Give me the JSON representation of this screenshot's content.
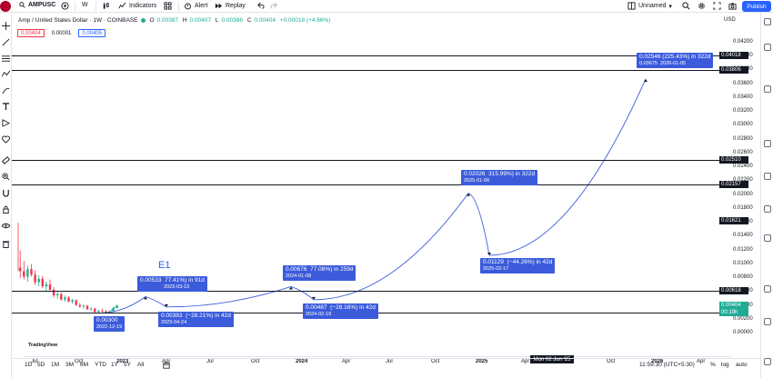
{
  "toolbar": {
    "symbol": "AMPUSC",
    "interval": "W",
    "indicators_label": "Indicators",
    "alert_label": "Alert",
    "replay_label": "Replay",
    "layout_name": "Unnamed",
    "publish_label": "Publish"
  },
  "legend": {
    "title": "Amp / United States Dollar · 1W · COINBASE",
    "open_label": "O",
    "open": "0.00387",
    "high_label": "H",
    "high": "0.00407",
    "low_label": "L",
    "low": "0.00386",
    "close_label": "C",
    "close": "0.00404",
    "change": "+0.00018 (+4.66%)",
    "bid": "0.00404",
    "spread": "0.00001",
    "ask": "0.00405"
  },
  "price_axis": {
    "currency": "USD",
    "ticks": [
      "0.04200",
      "0.04000",
      "0.03800",
      "0.03600",
      "0.03400",
      "0.03200",
      "0.03000",
      "0.02800",
      "0.02600",
      "0.02400",
      "0.02200",
      "0.02000",
      "0.01800",
      "0.01600",
      "0.01400",
      "0.01200",
      "0.01000",
      "0.00800",
      "0.00600",
      "0.00400",
      "0.00200",
      "0.00000"
    ],
    "levels": [
      "0.04018",
      "0.03806",
      "0.02510",
      "0.02157",
      "0.01621",
      "0.00618",
      "0.00404",
      "0.00301"
    ],
    "countdown": "00:19h"
  },
  "time_axis": {
    "ticks": [
      "Jul",
      "Oct",
      "2023",
      "Apr",
      "Jul",
      "Oct",
      "2024",
      "Apr",
      "Jul",
      "Oct",
      "2025",
      "Apr",
      "Jul",
      "Oct",
      "2026",
      "Apr"
    ],
    "crosshair_label": "Mon 02 Jun '25"
  },
  "annotations": {
    "wave_label": "E1",
    "tag1_price": "0.00300",
    "tag1_date": "2022-12-19",
    "tag2_price": "0.00533",
    "tag2_pct": "77.41%) in 91d",
    "tag2_date": "2023-03-13",
    "tag3_price": "0.00383",
    "tag3_pct": "(−28.21%) in 42d",
    "tag3_date": "2023-04-24",
    "tag4_price": "0.00676",
    "tag4_pct": "77.06%) in 259d",
    "tag4_date": "2024-01-08",
    "tag5_price": "0.00487",
    "tag5_pct": "(−28.16%) in 42d",
    "tag5_date": "2024-02-19",
    "tag6_price": "0.02026",
    "tag6_pct": "315.99%) in 322d",
    "tag6_date": "2025-01-06",
    "tag7_price": "0.01129",
    "tag7_pct": "(−44.26%) in 42d",
    "tag7_date": "2025-02-17",
    "tag8_pct": "0.02546 (225.43%) in 322d",
    "tag8_price": "0.03675",
    "tag8_date": "2026-01-05"
  },
  "bottom": {
    "ranges": [
      "1D",
      "5D",
      "1M",
      "3M",
      "6M",
      "YTD",
      "1Y",
      "5Y",
      "All"
    ],
    "clock": "11:59:30 (UTC+5:30)",
    "pct_label": "%",
    "log_label": "log",
    "auto_label": "auto",
    "watermark": "TradingView"
  },
  "colors": {
    "accent": "#2962ff",
    "up": "#22ab94",
    "down": "#f23645",
    "tag": "#3b5bdb"
  }
}
